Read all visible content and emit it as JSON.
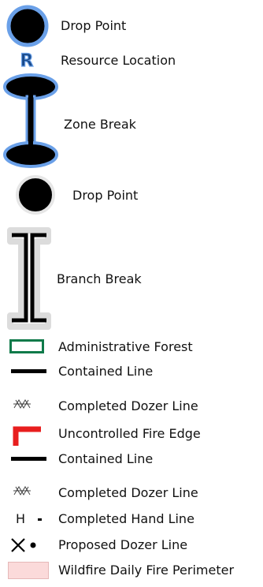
{
  "legend": {
    "items": [
      {
        "label": "Drop Point",
        "icon": "drop-point-blue-outline-icon"
      },
      {
        "label": "Resource Location",
        "icon": "resource-location-r-icon",
        "glyph": "R"
      },
      {
        "label": "Zone Break",
        "icon": "zone-break-icon"
      },
      {
        "label": "Drop Point",
        "icon": "drop-point-icon"
      },
      {
        "label": "Branch Break",
        "icon": "branch-break-icon"
      },
      {
        "label": "Administrative Forest",
        "icon": "administrative-forest-icon"
      },
      {
        "label": "Contained Line",
        "icon": "contained-line-icon"
      },
      {
        "label": "Completed Dozer Line",
        "icon": "completed-dozer-line-icon"
      },
      {
        "label": "Uncontrolled Fire Edge",
        "icon": "uncontrolled-fire-edge-icon"
      },
      {
        "label": "Contained Line",
        "icon": "contained-line-icon"
      },
      {
        "label": "Completed Dozer Line",
        "icon": "completed-dozer-line-icon"
      },
      {
        "label": "Completed Hand Line",
        "icon": "completed-hand-line-icon",
        "glyph": "H"
      },
      {
        "label": "Proposed Dozer Line",
        "icon": "proposed-dozer-line-icon"
      },
      {
        "label": "Wildfire Daily Fire Perimeter",
        "icon": "wildfire-daily-fire-perimeter-icon"
      }
    ]
  },
  "colors": {
    "blue_outline": "#6aa0e8",
    "black": "#000000",
    "forest_green": "#0f7a4a",
    "fire_red": "#e81e1e",
    "perimeter_fill": "#fbdada",
    "perimeter_border": "#e6b8b8"
  }
}
